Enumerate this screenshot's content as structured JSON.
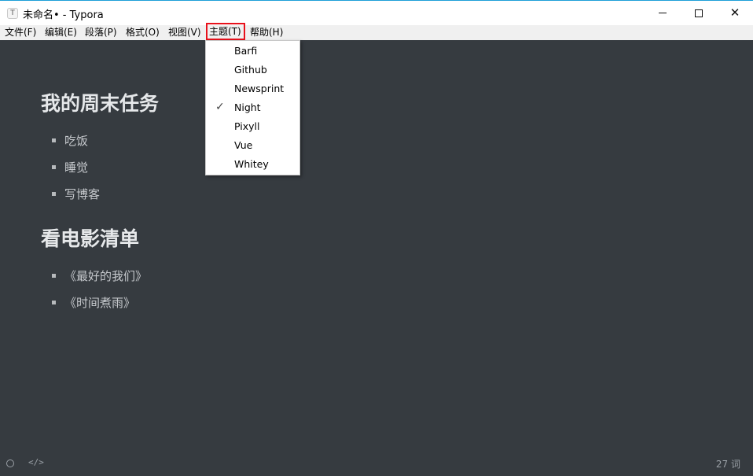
{
  "window": {
    "icon_letter": "T",
    "title": "未命名• - Typora",
    "minimize_glyph": "—",
    "close_glyph": "✕"
  },
  "menubar": {
    "items": [
      {
        "label": "文件(F)"
      },
      {
        "label": "编辑(E)"
      },
      {
        "label": "段落(P)"
      },
      {
        "label": "格式(O)"
      },
      {
        "label": "视图(V)"
      },
      {
        "label": "主题(T)",
        "active": true
      },
      {
        "label": "帮助(H)"
      }
    ]
  },
  "theme_menu": {
    "items": [
      {
        "label": "Barfi",
        "checked": false
      },
      {
        "label": "Github",
        "checked": false
      },
      {
        "label": "Newsprint",
        "checked": false
      },
      {
        "label": "Night",
        "checked": true
      },
      {
        "label": "Pixyll",
        "checked": false
      },
      {
        "label": "Vue",
        "checked": false
      },
      {
        "label": "Whitey",
        "checked": false
      }
    ],
    "check_glyph": "✓"
  },
  "document": {
    "sections": [
      {
        "heading": "我的周末任务",
        "items": [
          "吃饭",
          "睡觉",
          "写博客"
        ]
      },
      {
        "heading": "看电影清单",
        "items": [
          "《最好的我们》",
          "《时间煮雨》"
        ]
      }
    ]
  },
  "status": {
    "code_icon": "</>",
    "word_count": "27 词"
  },
  "colors": {
    "editor_bg": "#363b40",
    "accent": "#1e9fd8",
    "highlight": "#e8111b"
  }
}
